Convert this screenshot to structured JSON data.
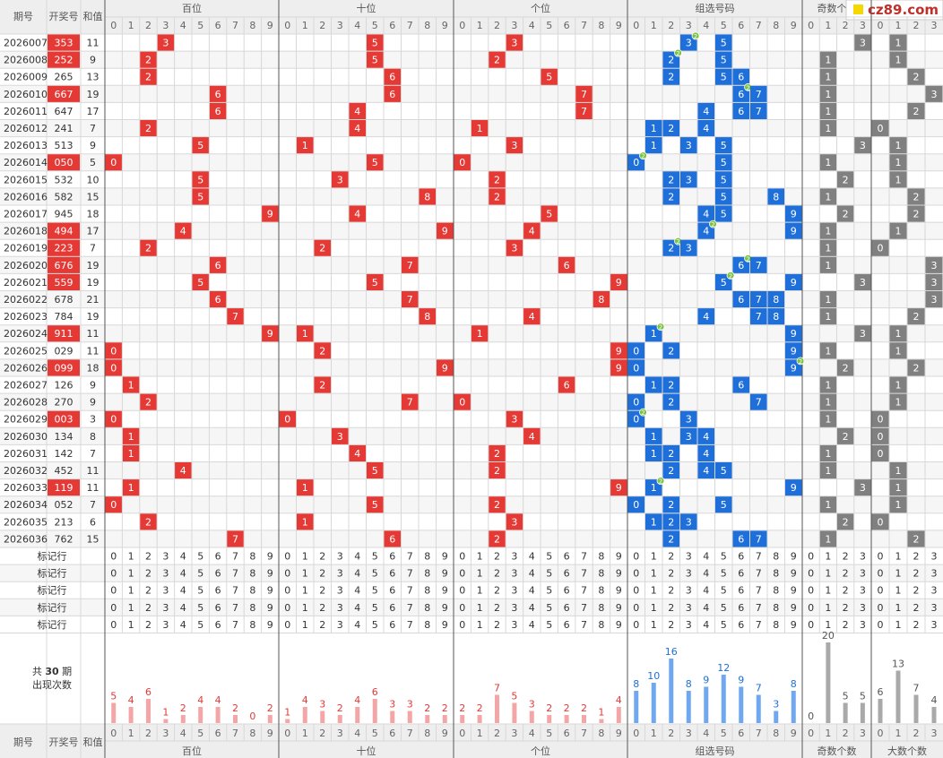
{
  "header": {
    "qh": "期号",
    "kjh": "开奖号",
    "hz": "和值",
    "groups": [
      "百位",
      "十位",
      "个位",
      "组选号码",
      "奇数个数",
      "大数个数"
    ],
    "site": "cz89.com"
  },
  "rows": [
    {
      "p": "2026007",
      "n": "353",
      "s": "11",
      "hl": true
    },
    {
      "p": "2026008",
      "n": "252",
      "s": "9",
      "hl": true
    },
    {
      "p": "2026009",
      "n": "265",
      "s": "13",
      "hl": false
    },
    {
      "p": "2026010",
      "n": "667",
      "s": "19",
      "hl": true
    },
    {
      "p": "2026011",
      "n": "647",
      "s": "17",
      "hl": false
    },
    {
      "p": "2026012",
      "n": "241",
      "s": "7",
      "hl": false
    },
    {
      "p": "2026013",
      "n": "513",
      "s": "9",
      "hl": false
    },
    {
      "p": "2026014",
      "n": "050",
      "s": "5",
      "hl": true
    },
    {
      "p": "2026015",
      "n": "532",
      "s": "10",
      "hl": false
    },
    {
      "p": "2026016",
      "n": "582",
      "s": "15",
      "hl": false
    },
    {
      "p": "2026017",
      "n": "945",
      "s": "18",
      "hl": false
    },
    {
      "p": "2026018",
      "n": "494",
      "s": "17",
      "hl": true
    },
    {
      "p": "2026019",
      "n": "223",
      "s": "7",
      "hl": true
    },
    {
      "p": "2026020",
      "n": "676",
      "s": "19",
      "hl": true
    },
    {
      "p": "2026021",
      "n": "559",
      "s": "19",
      "hl": true
    },
    {
      "p": "2026022",
      "n": "678",
      "s": "21",
      "hl": false
    },
    {
      "p": "2026023",
      "n": "784",
      "s": "19",
      "hl": false
    },
    {
      "p": "2026024",
      "n": "911",
      "s": "11",
      "hl": true
    },
    {
      "p": "2026025",
      "n": "029",
      "s": "11",
      "hl": false
    },
    {
      "p": "2026026",
      "n": "099",
      "s": "18",
      "hl": true
    },
    {
      "p": "2026027",
      "n": "126",
      "s": "9",
      "hl": false
    },
    {
      "p": "2026028",
      "n": "270",
      "s": "9",
      "hl": false
    },
    {
      "p": "2026029",
      "n": "003",
      "s": "3",
      "hl": true
    },
    {
      "p": "2026030",
      "n": "134",
      "s": "8",
      "hl": false
    },
    {
      "p": "2026031",
      "n": "142",
      "s": "7",
      "hl": false
    },
    {
      "p": "2026032",
      "n": "452",
      "s": "11",
      "hl": false
    },
    {
      "p": "2026033",
      "n": "119",
      "s": "11",
      "hl": true
    },
    {
      "p": "2026034",
      "n": "052",
      "s": "7",
      "hl": false
    },
    {
      "p": "2026035",
      "n": "213",
      "s": "6",
      "hl": false
    },
    {
      "p": "2026036",
      "n": "762",
      "s": "15",
      "hl": false
    }
  ],
  "marker_label": "标记行",
  "summary_label": "共 30 期\n出现次数",
  "summary_label_period": "共",
  "summary_label_count": "30",
  "summary_label_unit": "期",
  "summary_label_line2": "出现次数",
  "chart_data": {
    "type": "bar",
    "title": "共 30 期 出现次数",
    "groups": [
      {
        "name": "百位",
        "categories": [
          "0",
          "1",
          "2",
          "3",
          "4",
          "5",
          "6",
          "7",
          "8",
          "9"
        ],
        "values": [
          5,
          4,
          6,
          1,
          2,
          4,
          4,
          2,
          0,
          2
        ],
        "color": "#f4a6a6",
        "label_color": "#e53935"
      },
      {
        "name": "十位",
        "categories": [
          "0",
          "1",
          "2",
          "3",
          "4",
          "5",
          "6",
          "7",
          "8",
          "9"
        ],
        "values": [
          1,
          4,
          3,
          2,
          4,
          6,
          3,
          3,
          2,
          2
        ],
        "color": "#f4a6a6",
        "label_color": "#e53935"
      },
      {
        "name": "个位",
        "categories": [
          "0",
          "1",
          "2",
          "3",
          "4",
          "5",
          "6",
          "7",
          "8",
          "9"
        ],
        "values": [
          2,
          2,
          7,
          5,
          3,
          2,
          2,
          2,
          1,
          4
        ],
        "color": "#f4a6a6",
        "label_color": "#e53935"
      },
      {
        "name": "组选号码",
        "categories": [
          "0",
          "1",
          "2",
          "3",
          "4",
          "5",
          "6",
          "7",
          "8",
          "9"
        ],
        "values": [
          8,
          10,
          16,
          8,
          9,
          12,
          9,
          7,
          3,
          8
        ],
        "color": "#6fa8f0",
        "label_color": "#1e6fd9"
      },
      {
        "name": "奇数个数",
        "categories": [
          "0",
          "1",
          "2",
          "3"
        ],
        "values": [
          0,
          20,
          5,
          5
        ],
        "color": "#a9a9a9",
        "label_color": "#555555"
      },
      {
        "name": "大数个数",
        "categories": [
          "0",
          "1",
          "2",
          "3"
        ],
        "values": [
          6,
          13,
          7,
          4
        ],
        "color": "#a9a9a9",
        "label_color": "#555555"
      }
    ]
  },
  "colors": {
    "red": "#e53935",
    "blue": "#1e6fd9",
    "gray": "#808080",
    "green": "#7cc242",
    "bar_red": "#f4a6a6",
    "bar_blue": "#6fa8f0",
    "bar_gray": "#a9a9a9",
    "line": "#d8d8d8",
    "alt": "#f6f6f6",
    "head": "#eeeeee"
  },
  "icons": {
    "logo": "yellow-square-logo"
  }
}
